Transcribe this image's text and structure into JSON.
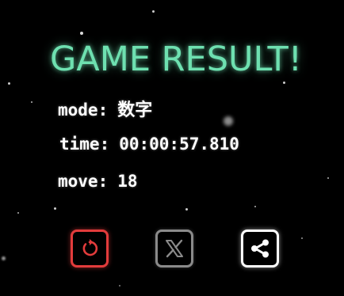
{
  "title": "GAME RESULT!",
  "result": {
    "mode_label": "mode:",
    "mode_value": "数字",
    "time_label": "time:",
    "time_value": "00:00:57.810",
    "move_label": "move:",
    "move_value": "18"
  },
  "buttons": {
    "retry_icon": "retry-icon",
    "x_icon": "x-logo-icon",
    "share_icon": "share-icon"
  },
  "colors": {
    "background": "#000000",
    "title": "#6ee0b0",
    "retry": "#e23c3c",
    "x": "#8a8a8a",
    "share": "#ffffff"
  }
}
